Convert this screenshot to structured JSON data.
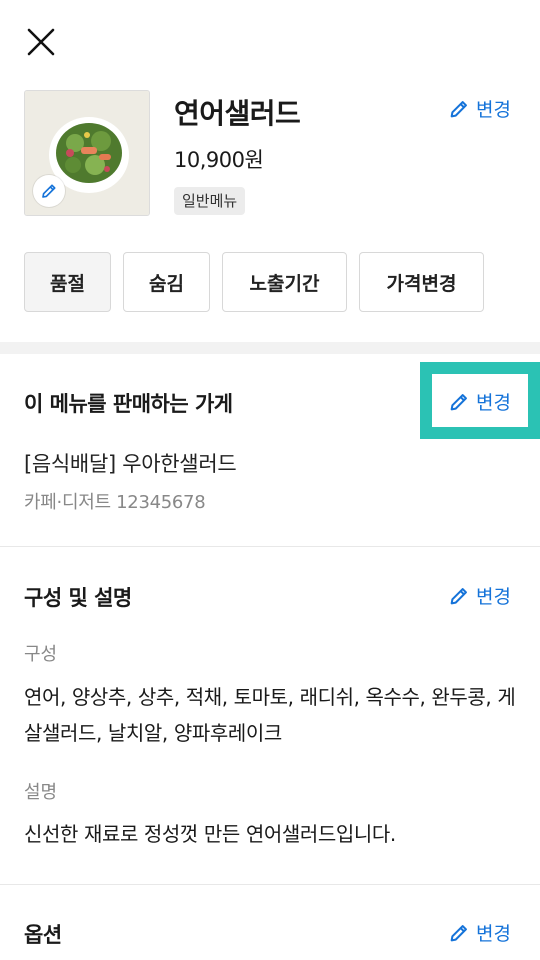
{
  "colors": {
    "accent": "#1573d9",
    "highlight": "#2bc2b4"
  },
  "header": {
    "close_icon": "close-icon"
  },
  "product": {
    "name": "연어샐러드",
    "price": "10,900원",
    "badge": "일반메뉴",
    "edit_label": "변경",
    "image_icon": "pencil-icon"
  },
  "actions": [
    "품절",
    "숨김",
    "노출기간",
    "가격변경"
  ],
  "store_section": {
    "title": "이 메뉴를 판매하는 가게",
    "edit_label": "변경",
    "store_name": "[음식배달] 우아한샐러드",
    "store_category": "카페·디저트 12345678"
  },
  "composition_section": {
    "title": "구성 및 설명",
    "edit_label": "변경",
    "composition_label": "구성",
    "composition_text": "연어, 양상추, 상추, 적채, 토마토, 래디쉬, 옥수수, 완두콩, 게살샐러드, 날치알, 양파후레이크",
    "description_label": "설명",
    "description_text": "신선한 재료로 정성껏 만든 연어샐러드입니다."
  },
  "options_section": {
    "title": "옵션",
    "edit_label": "변경"
  }
}
